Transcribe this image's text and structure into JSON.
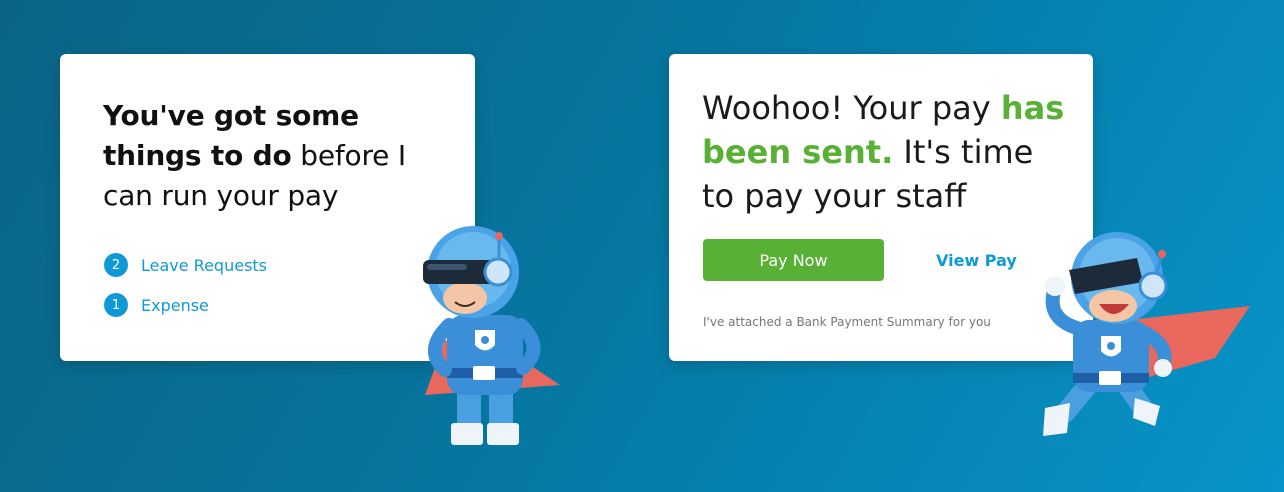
{
  "left_card": {
    "headline_bold": "You've got some things to do",
    "headline_rest": " before I can run your pay",
    "todos": [
      {
        "count": "2",
        "label": "Leave Requests"
      },
      {
        "count": "1",
        "label": "Expense"
      }
    ]
  },
  "right_card": {
    "headline_part1": "Woohoo! Your pay ",
    "headline_highlight": "has been sent.",
    "headline_part2": " It's time to pay your staff",
    "pay_now_label": "Pay Now",
    "view_pay_label": "View Pay",
    "note": "I've attached a Bank Payment Summary for you"
  },
  "colors": {
    "accent_blue": "#0f9ad7",
    "accent_green": "#58b135",
    "background_start": "#0b6485",
    "background_end": "#0794c8"
  },
  "icons": [
    "mascot-standing",
    "mascot-jumping",
    "shield-icon"
  ]
}
